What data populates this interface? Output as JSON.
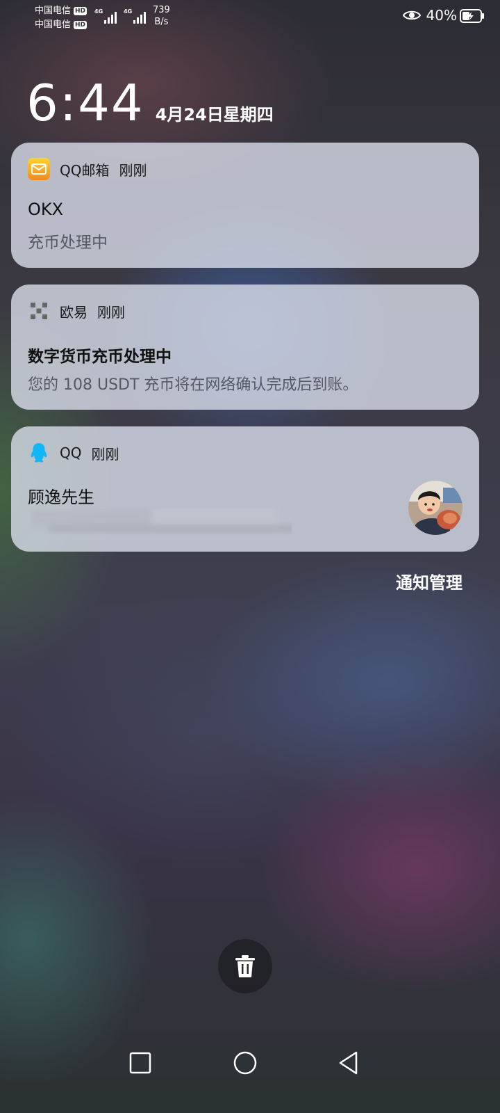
{
  "status_bar": {
    "carrier1": "中国电信",
    "carrier2": "中国电信",
    "hd_badge": "HD",
    "net_type1": "4G",
    "net_type2": "4G",
    "net_speed_value": "739",
    "net_speed_unit": "B/s",
    "battery_percent": "40%",
    "icons": [
      "eye-icon",
      "battery-charging-icon",
      "signal-icon"
    ]
  },
  "lockscreen": {
    "time": "6:44",
    "date": "4月24日星期四"
  },
  "notifications": [
    {
      "app": "QQ邮箱",
      "time": "刚刚",
      "title": "OKX",
      "body": "充币处理中",
      "icon": "mail-icon",
      "accent": "#F5A623"
    },
    {
      "app": "欧易",
      "time": "刚刚",
      "title": "数字货币充币处理中",
      "body": "您的 108 USDT 充币将在网络确认完成后到账。",
      "icon": "okx-logo-icon",
      "accent": "#666666"
    },
    {
      "app": "QQ",
      "time": "刚刚",
      "title": "顾逸先生",
      "body": "",
      "icon": "qq-penguin-icon",
      "accent": "#12B7F5"
    }
  ],
  "actions": {
    "manage_label": "通知管理",
    "clear_icon": "trash-icon"
  },
  "navigation": {
    "icons": [
      "recents-square-icon",
      "home-circle-icon",
      "back-triangle-icon"
    ]
  }
}
